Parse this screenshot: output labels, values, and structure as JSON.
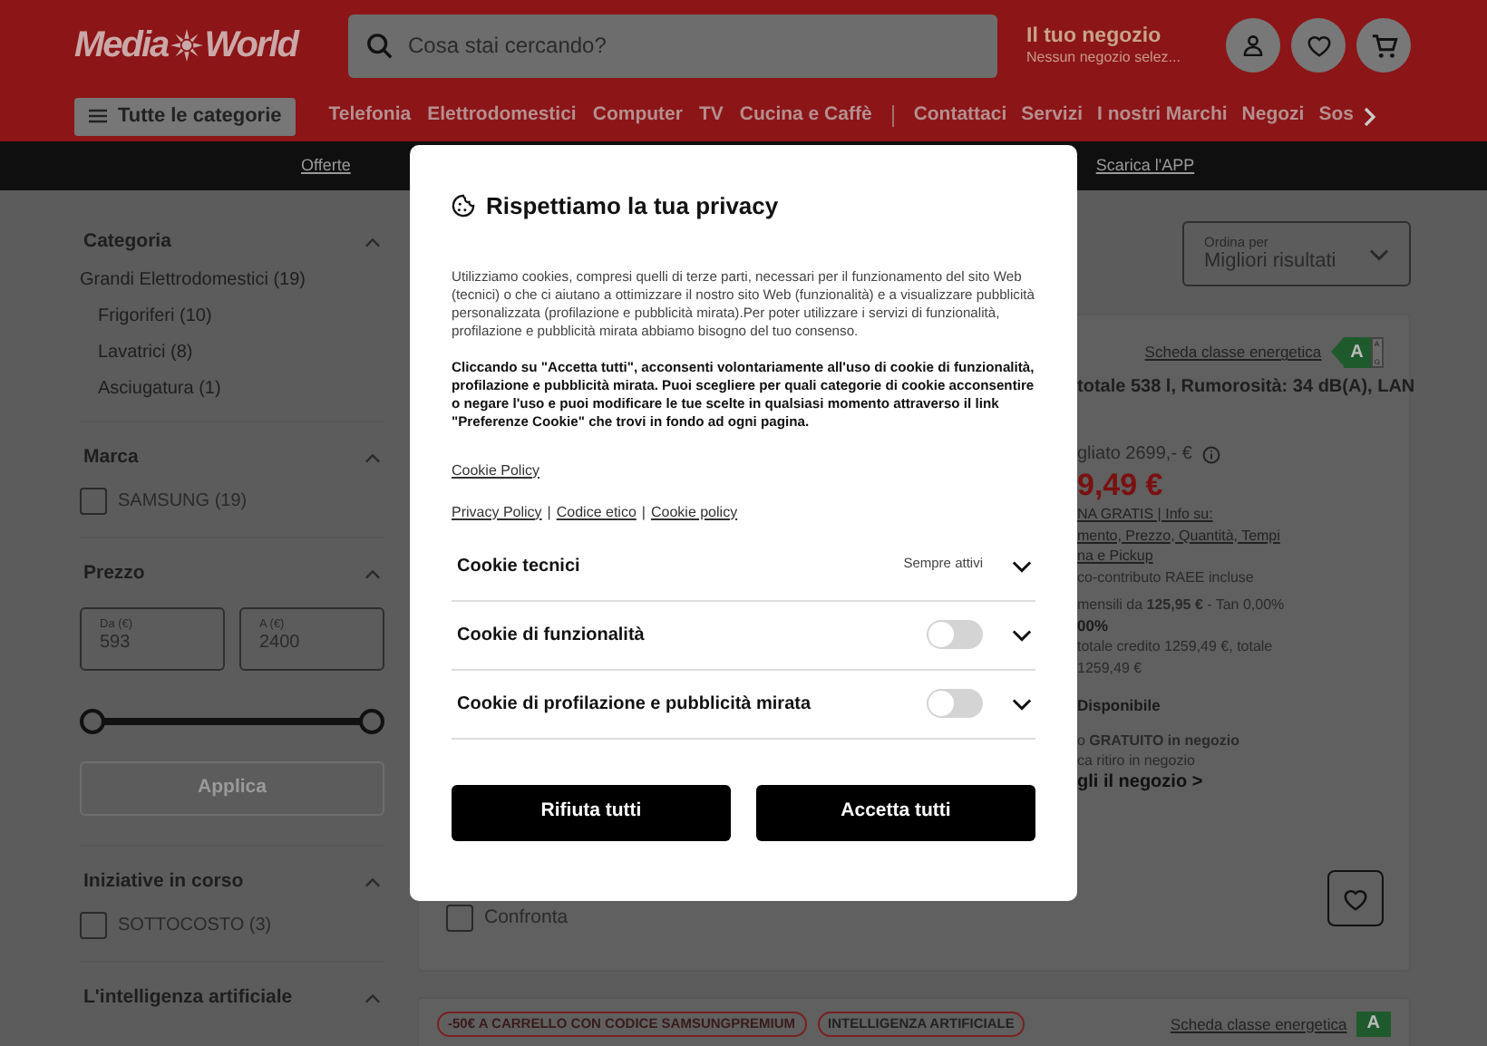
{
  "header": {
    "logo": {
      "left": "Media",
      "right": "World"
    },
    "search": {
      "placeholder": "Cosa stai cercando?"
    },
    "store": {
      "title": "Il tuo negozio",
      "subtitle": "Nessun negozio selez..."
    }
  },
  "categories_button": "Tutte le categorie",
  "nav_primary": [
    "Telefonia",
    "Elettrodomestici",
    "Computer",
    "TV",
    "Cucina e Caffè"
  ],
  "nav_secondary": [
    "Contattaci",
    "Servizi",
    "I nostri Marchi",
    "Negozi",
    "Sos"
  ],
  "promo_bar": {
    "left": "Offerte",
    "right": "Scarica l'APP"
  },
  "filters": [
    {
      "kind": "tree",
      "title": "Categoria",
      "expanded": true,
      "items": [
        {
          "label": "Grandi Elettrodomestici (19)",
          "children": [
            {
              "label": "Frigoriferi (10)"
            },
            {
              "label": "Lavatrici (8)"
            },
            {
              "label": "Asciugatura (1)"
            }
          ]
        }
      ]
    },
    {
      "kind": "checkboxes",
      "title": "Marca",
      "expanded": true,
      "items": [
        {
          "label": "SAMSUNG (19)",
          "checked": false
        }
      ]
    },
    {
      "kind": "price",
      "title": "Prezzo",
      "expanded": true,
      "fields": [
        {
          "label": "Da (€)",
          "value": "593"
        },
        {
          "label": "A (€)",
          "value": "2400"
        }
      ],
      "thumbs": [
        {
          "level": 0
        },
        {
          "level": 1
        }
      ],
      "apply": {
        "label": "Applica",
        "disabled": true
      }
    },
    {
      "kind": "checkboxes",
      "title": "Iniziative in corso",
      "expanded": true,
      "items": [
        {
          "label": "SOTTOCOSTO (3)",
          "checked": false
        }
      ]
    },
    {
      "kind": "heading",
      "title": "L'intelligenza artificiale",
      "expanded": true
    }
  ],
  "sort": {
    "label": "Ordina per",
    "value": "Migliori risultati"
  },
  "products": [
    {
      "energy": {
        "link": "Scheda classe energetica",
        "class": "A",
        "scale_top": "A",
        "scale_bottom": "G"
      },
      "blocks": [
        [
          {
            "kind": "title",
            "text": "totale 538 l, Rumorosità: 34 dB(A), LAN"
          }
        ],
        [
          {
            "kind": "strike",
            "text": "gliato 2699,- €"
          },
          {
            "kind": "price",
            "text": "9,49 €"
          },
          {
            "kind": "link",
            "text": "NA GRATIS | Info su:"
          },
          {
            "kind": "link",
            "text": "mento, Prezzo, Quantità, Tempi"
          },
          {
            "kind": "link",
            "text": "na e Pickup"
          },
          {
            "kind": "small",
            "text": "co-contributo RAEE incluse"
          }
        ],
        [
          {
            "kind": "small",
            "text": "mensili da **125,95 €** - Tan 0,00%"
          },
          {
            "kind": "bold",
            "text": "00%"
          },
          {
            "kind": "small",
            "text": "totale credito 1259,49 €, totale"
          },
          {
            "kind": "small",
            "text": "1259,49 €"
          }
        ],
        [
          {
            "kind": "bold",
            "text": "Disponibile"
          }
        ],
        [
          {
            "kind": "small",
            "text": "o **GRATUITO in negozio**"
          },
          {
            "kind": "small",
            "text": "ca ritiro in negozio"
          },
          {
            "kind": "strong",
            "text": "gli il negozio >"
          }
        ]
      ],
      "compare": {
        "label": "Confronta",
        "checked": false
      }
    },
    {
      "tags": [
        "-50€ A CARRELLO CON CODICE SAMSUNGPREMIUM",
        "INTELLIGENZA ARTIFICIALE"
      ],
      "energy": {
        "link": "Scheda classe energetica",
        "class": "A"
      }
    }
  ],
  "consent": {
    "title": "Rispettiamo la tua privacy",
    "paragraphs": [
      {
        "kind": "normal",
        "text": "Utilizziamo cookies, compresi quelli di terze parti, necessari per il funzionamento del sito Web (tecnici) o che ci aiutano a ottimizzare il nostro sito Web (funzionalità) e a visualizzare pubblicità personalizzata (profilazione e pubblicità mirata).Per poter utilizzare i servizi di funzionalità, profilazione e pubblicità mirata abbiamo bisogno del tuo consenso."
      },
      {
        "kind": "bold",
        "text": "Cliccando su \"Accetta tutti\", acconsenti volontariamente all'uso di cookie di funzionalità, profilazione e pubblicità mirata. Puoi scegliere per quali categorie di cookie acconsentire o negare l'uso e puoi modificare le tue scelte in qualsiasi momento attraverso il link \"Preferenze Cookie\" che trovi in fondo ad ogni pagina."
      }
    ],
    "policy_link": "Cookie Policy",
    "links": [
      "Privacy Policy",
      "Codice etico",
      "Cookie policy"
    ],
    "separator": "|",
    "categories": [
      {
        "label": "Cookie tecnici",
        "kind": "always",
        "note": "Sempre attivi",
        "expanded": false
      },
      {
        "label": "Cookie di funzionalità",
        "kind": "toggle",
        "on": false,
        "expanded": false
      },
      {
        "label": "Cookie di profilazione e pubblicità mirata",
        "kind": "toggle",
        "on": false,
        "expanded": false
      }
    ],
    "buttons": [
      {
        "label": "Rifiuta tutti"
      },
      {
        "label": "Accetta tutti"
      }
    ]
  }
}
